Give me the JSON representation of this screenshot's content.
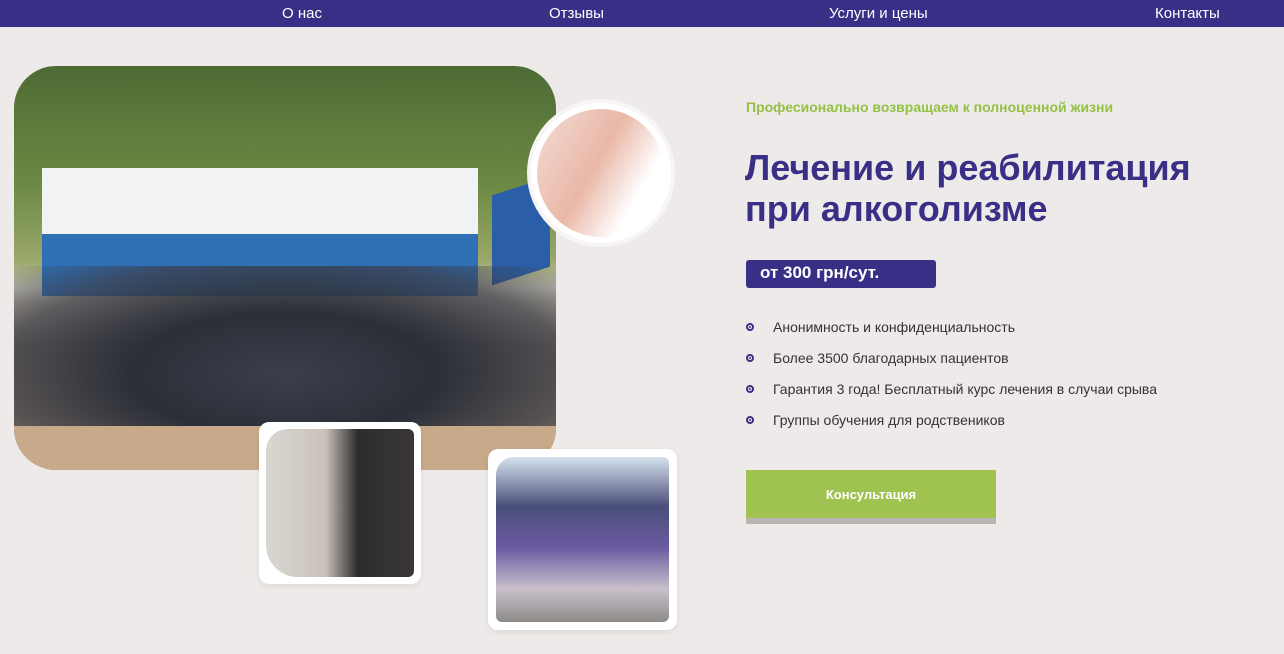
{
  "nav": {
    "items": [
      {
        "label": "О нас"
      },
      {
        "label": "Отзывы"
      },
      {
        "label": "Услуги и цены"
      },
      {
        "label": "Контакты"
      }
    ]
  },
  "hero": {
    "tagline": "Професионально возвращаем к полноценной жизни",
    "title_line1": "Лечение и реабилитация",
    "title_line2": "при алкоголизме",
    "price": "от 300 грн/сут.",
    "features": [
      "Анонимность и конфиденциальность",
      "Более 3500 благодарных пациентов",
      "Гарантия 3 года! Бесплатный курс лечения в случаи срыва",
      "Группы обучения для родствеников"
    ],
    "cta_label": "Консультация"
  },
  "colors": {
    "nav_bg": "#3a2f86",
    "accent_green": "#9fc250",
    "title_purple": "#3a2f86",
    "page_bg": "#eeeae9"
  }
}
